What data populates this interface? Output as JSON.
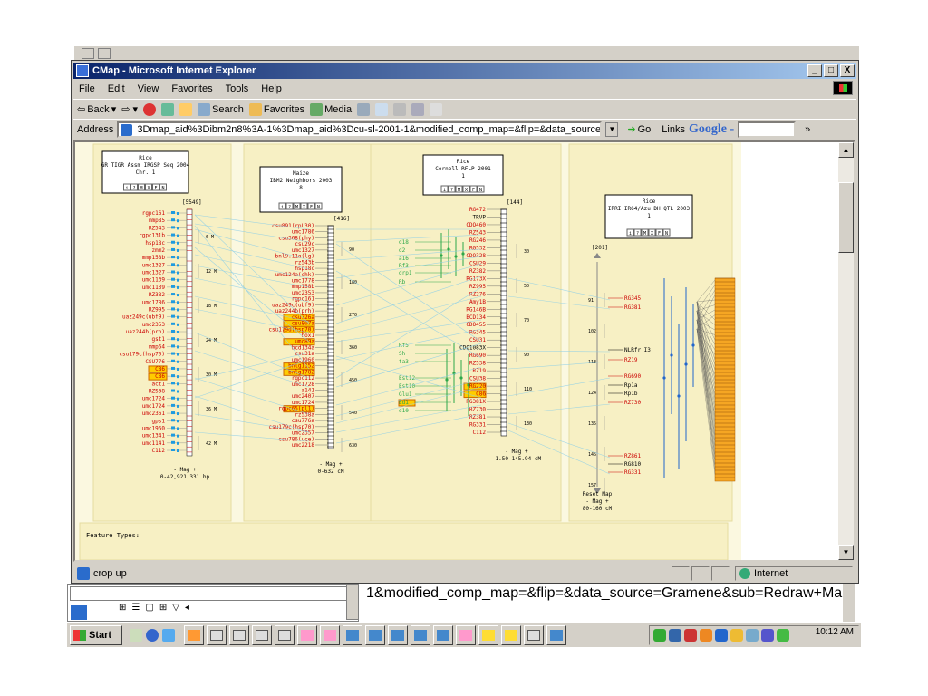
{
  "window": {
    "title": "CMap - Microsoft Internet Explorer",
    "minimize": "_",
    "maximize": "□",
    "close": "X"
  },
  "menu": [
    "File",
    "Edit",
    "View",
    "Favorites",
    "Tools",
    "Help"
  ],
  "toolbar": {
    "back": "Back",
    "search": "Search",
    "favorites": "Favorites",
    "media": "Media"
  },
  "address": {
    "label": "Address",
    "url": "3Dmap_aid%3Dibm2n8%3A-1%3Dmap_aid%3Dcu-sl-2001-1&modified_comp_map=&flip=&data_source=Gramene&sub=Redraw+Map",
    "go": "Go",
    "links": "Links",
    "google": "Google -",
    "chevron": "»"
  },
  "maps": {
    "rice_seq": {
      "title_lines": [
        "Rice",
        "GR TIGR Assm IRGSP Seq 2004",
        "Chr. 1"
      ],
      "count": "[5549]",
      "scale": "- Mag +",
      "range": "0-42,921,331 bp"
    },
    "maize": {
      "title_lines": [
        "Maize",
        "IBM2 Neighbors 2003",
        "8"
      ],
      "count": "[416]",
      "scale": "- Mag +",
      "range": "0-632 cM"
    },
    "cornell": {
      "title_lines": [
        "Rice",
        "Cornell RFLP 2001",
        "1"
      ],
      "count": "[144]",
      "scale": "- Mag +",
      "range": "-1.50-145.94 cM"
    },
    "qtl": {
      "title_lines": [
        "Rice",
        "IRRI IR64/Azu DH QTL 2003",
        "1"
      ],
      "count": "[201]",
      "reset": "Reset Map",
      "scale": "- Mag +",
      "range": "80-160 cM"
    },
    "buttons": [
      "i",
      "?",
      "M",
      "X",
      "F",
      "N"
    ]
  },
  "labels": {
    "rice": [
      "rgpc161",
      "mmp85",
      "RZ543",
      "rgpc131b",
      "hsp18c",
      "zmm2",
      "mmp158b",
      "umc1327",
      "umc1327",
      "umc1139",
      "umc1139",
      "RZ382",
      "umc1786",
      "RZ995",
      "uaz249c(ubf9)",
      "umc2353",
      "uaz244b(prh)",
      "gst1",
      "mmp64",
      "csu179c(hsp70)",
      "CSU776",
      "C86",
      "C86",
      "act1",
      "RZ538",
      "umc1724",
      "umc1724",
      "umc2361",
      "gps1",
      "umc1960",
      "umc1341",
      "umc1141",
      "C112"
    ],
    "rice_highlight": [
      21,
      22
    ],
    "maize": [
      "csu891(rpL30)",
      "umc1786",
      "csu368(phy)",
      "csu29c",
      "umc1327",
      "bnl9.11a(lg)",
      "rz543b",
      "hsp18c",
      "umc124a(chk)",
      "umc1778",
      "mmp158b",
      "umc2353",
      "rgpc161",
      "uaz249c(ubf9)",
      "uaz244b(prh)",
      "csu726a",
      "csu807a",
      "csu179d(hsp70)",
      "hox1",
      "umc89a",
      "bcd134a",
      "csu31a",
      "umc1960",
      "bnlg1152",
      "bnlg1782",
      "rgpc112",
      "umc1728",
      "a141",
      "umc2407",
      "umc1724",
      "rgpc65(pl1)",
      "rz538a",
      "csu776a",
      "csu179c(hsp70)",
      "umc2357",
      "csu786(uce)",
      "umc2218"
    ],
    "maize_highlight": [
      15,
      16,
      17,
      19,
      23,
      24,
      30
    ],
    "cornell_left": [
      "d18",
      "d2",
      "a16",
      "Rf3",
      "drp1",
      "Rb",
      "Rf5",
      "Sh",
      "ta3",
      "Est12",
      "Est10",
      "Glu1",
      "Ed1",
      "d10"
    ],
    "cornell_right": [
      "RG472",
      "TRVP",
      "CDO460",
      "RZ543",
      "RG246",
      "RG532",
      "CDO328",
      "CSU29",
      "RZ382",
      "RG173X",
      "RZ995",
      "RZ276",
      "Amy1B",
      "RG146B",
      "BCD134",
      "CDO455",
      "RG345",
      "CSU31",
      "CDO1083X",
      "RG690",
      "RZ538",
      "RZ19",
      "CSU38",
      "RG220",
      "C86",
      "RG381X",
      "RZ730",
      "RZ381",
      "RG331",
      "C112"
    ],
    "cornell_highlight": [
      23,
      24
    ],
    "qtl": [
      "RG345",
      "RG381",
      "NLRfr I3",
      "RZ19",
      "RG690",
      "Rp1a",
      "Rp1b",
      "RZ730",
      "RZ861",
      "RG810",
      "RG331"
    ],
    "qtl_black": [
      2,
      5,
      6,
      9
    ]
  },
  "ticks": {
    "rice": [
      "6 M",
      "12 M",
      "18 M",
      "24 M",
      "30 M",
      "36 M",
      "42 M"
    ],
    "maize": [
      "90",
      "180",
      "270",
      "360",
      "450",
      "540",
      "630"
    ],
    "cornell": [
      "30",
      "50",
      "70",
      "90",
      "110",
      "130"
    ],
    "qtl": [
      "91",
      "102",
      "113",
      "124",
      "135",
      "146",
      "157"
    ]
  },
  "footer_label": "Feature Types:",
  "status": {
    "text": "crop up",
    "zone": "Internet"
  },
  "under_text": "1&modified_comp_map=&flip=&data_source=Gramene&sub=Redraw+Map",
  "taskbar": {
    "start": "Start",
    "clock": "10:12 AM"
  },
  "colors": {
    "map_bg": "#fbf8e0",
    "panel": "#f7f0c4",
    "red_label": "#cc0000",
    "blue_feature": "#1e9be0",
    "green_feature": "#2ea84a",
    "highlight": "#ffcc00"
  }
}
